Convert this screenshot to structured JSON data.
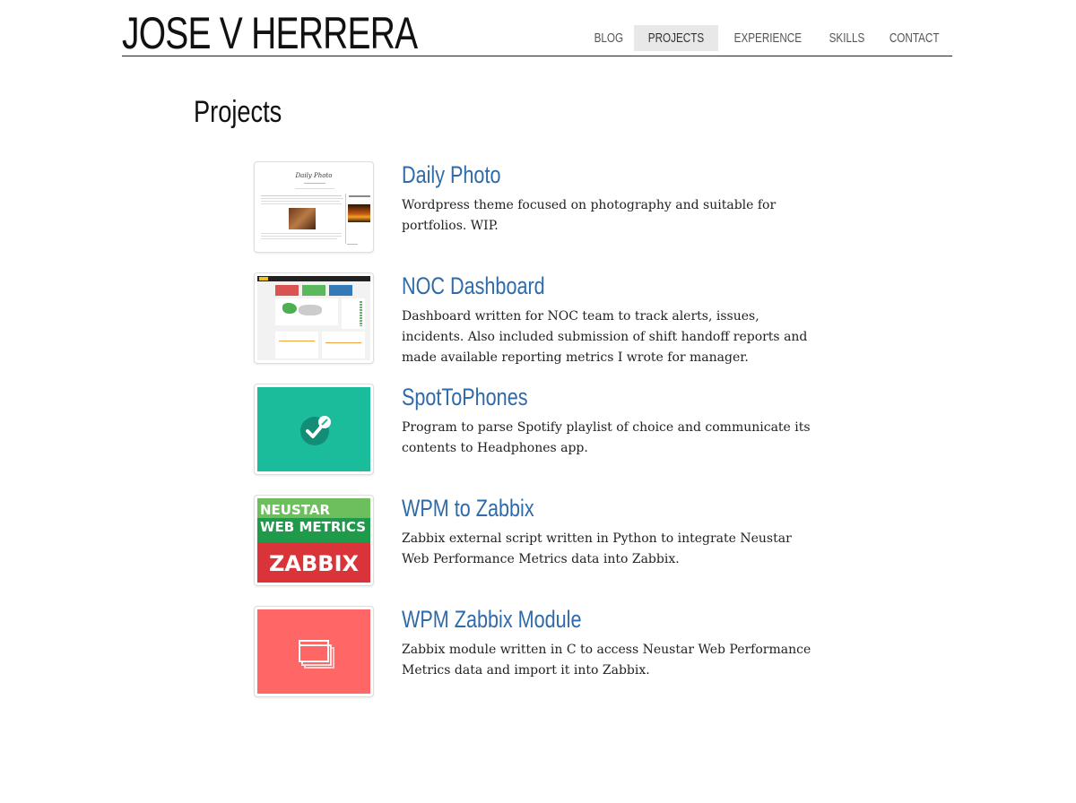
{
  "site": {
    "title": "JOSE V HERRERA"
  },
  "nav": {
    "items": [
      {
        "label": "BLOG"
      },
      {
        "label": "PROJECTS",
        "active": true
      },
      {
        "label": "EXPERIENCE"
      },
      {
        "label": "SKILLS"
      },
      {
        "label": "CONTACT"
      }
    ]
  },
  "page": {
    "title": "Projects"
  },
  "projects": [
    {
      "title": "Daily Photo",
      "description": "Wordpress theme focused on photography and suitable for portfolios. WIP.",
      "thumbnail": {
        "kind": "website-screenshot",
        "heading": "Daily Photo"
      }
    },
    {
      "title": "NOC Dashboard",
      "description": "Dashboard written for NOC team to track alerts, issues, incidents. Also included submission of shift handoff reports and made available reporting metrics I wrote for manager.",
      "thumbnail": {
        "kind": "dashboard-screenshot"
      }
    },
    {
      "title": "SpotToPhones",
      "description": "Program to parse Spotify playlist of choice and communicate its contents to Headphones app.",
      "thumbnail": {
        "kind": "icon",
        "icon": "check-edit-icon",
        "color": "#1abc9c"
      }
    },
    {
      "title": "WPM to Zabbix",
      "description": "Zabbix external script written in Python to integrate Neustar Web Performance Metrics data into Zabbix.",
      "thumbnail": {
        "kind": "logo",
        "line1": "NEUSTAR",
        "line2": "WEB METRICS",
        "line3": "ZABBIX",
        "top_color": "#5cb85c",
        "bottom_color": "#d9343a"
      }
    },
    {
      "title": "WPM Zabbix Module",
      "description": "Zabbix module written in C to access Neustar Web Performance Metrics data and import it into Zabbix.",
      "thumbnail": {
        "kind": "icon",
        "icon": "windows-stack-icon",
        "color": "#ff6666"
      }
    }
  ]
}
